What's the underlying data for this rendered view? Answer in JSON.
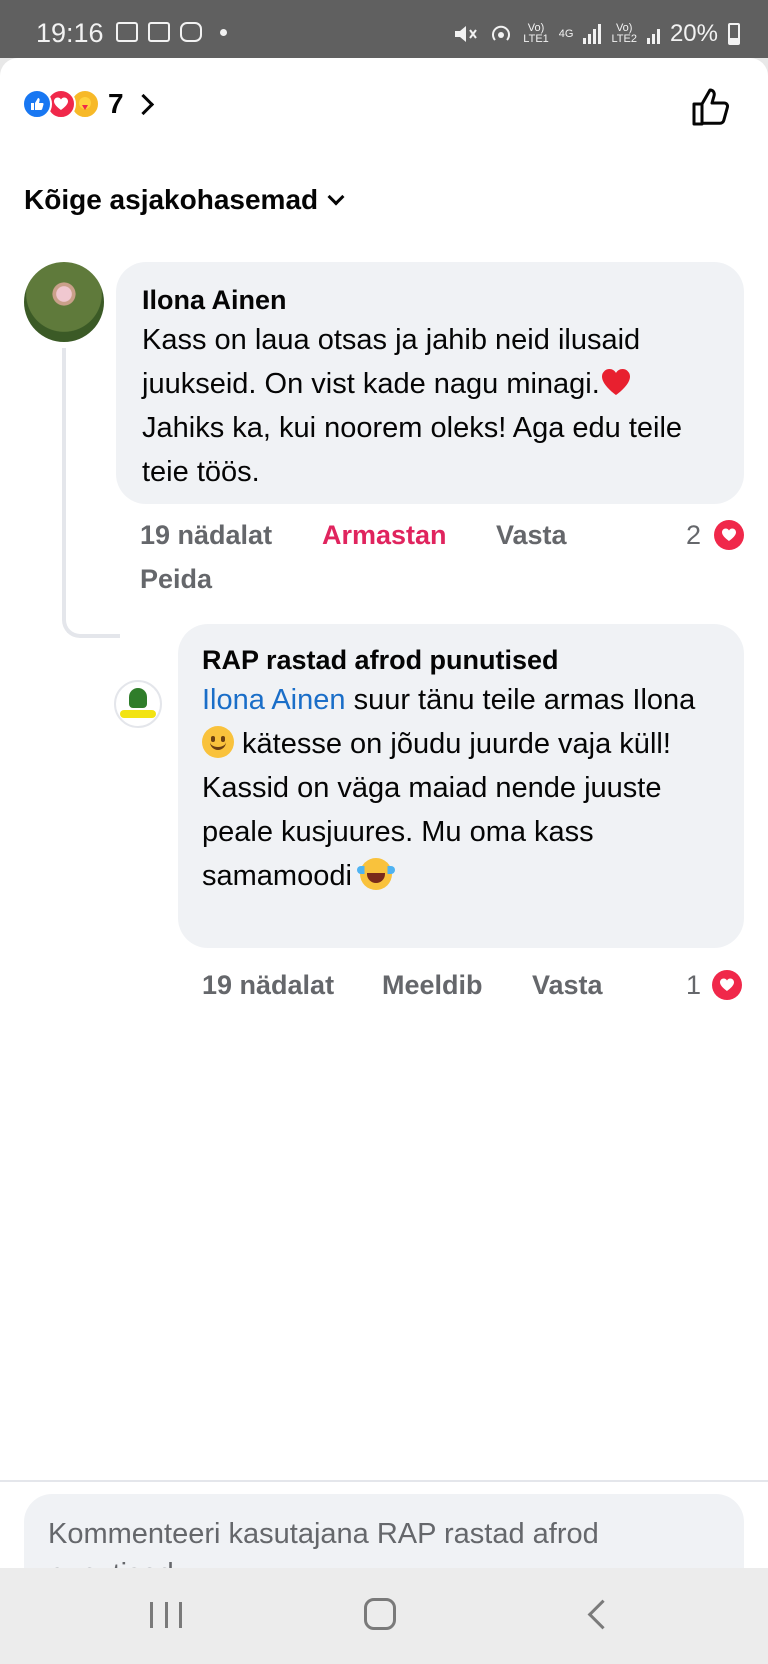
{
  "status_bar": {
    "time": "19:16",
    "sim1_top": "Vo)",
    "sim1_bottom": "LTE1",
    "net": "4G",
    "sim2_top": "Vo)",
    "sim2_bottom": "LTE2",
    "battery": "20%"
  },
  "reactions": {
    "count": "7",
    "icons": [
      "like-icon",
      "love-icon",
      "care-icon"
    ]
  },
  "sort": {
    "label": "Kõige asjakohasemad"
  },
  "comments": [
    {
      "author": "Ilona Ainen",
      "text_parts": {
        "a": "Kass on laua otsas ja jahib neid ilusaid juukseid. On vist kade nagu minagi.",
        "b": " Jahiks ka, kui noorem oleks! Aga edu teile teie töös."
      },
      "time": "19 nädalat",
      "reaction_label": "Armastan",
      "reply_label": "Vasta",
      "hide_label": "Peida",
      "reaction_count": "2"
    },
    {
      "author": "RAP rastad afrod punutised",
      "mention": "Ilona Ainen",
      "text_parts": {
        "a": " suur tänu teile armas Ilona ",
        "b": " kätesse on jõudu juurde vaja küll!",
        "c": "Kassid on väga maiad nende juuste peale kusjuures. Mu oma kass samamoodi "
      },
      "time": "19 nädalat",
      "reaction_label": "Meeldib",
      "reply_label": "Vasta",
      "reaction_count": "1"
    }
  ],
  "composer": {
    "placeholder": "Kommenteeri kasutajana RAP rastad afrod punutised"
  }
}
